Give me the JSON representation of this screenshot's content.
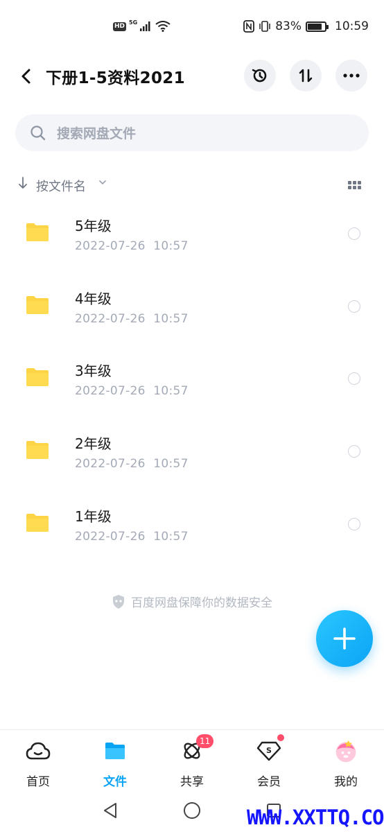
{
  "status_bar": {
    "network": "5G",
    "battery": "83%",
    "battery_level": 0.83,
    "time": "10:59"
  },
  "header": {
    "title": "下册1-5资料2021",
    "history_icon": "history-icon",
    "sort_icon": "sort-swap-icon",
    "more_icon": "more-icon"
  },
  "search": {
    "placeholder": "搜索网盘文件"
  },
  "sort": {
    "label": "按文件名"
  },
  "files": [
    {
      "name": "5年级",
      "date": "2022-07-26",
      "time": "10:57"
    },
    {
      "name": "4年级",
      "date": "2022-07-26",
      "time": "10:57"
    },
    {
      "name": "3年级",
      "date": "2022-07-26",
      "time": "10:57"
    },
    {
      "name": "2年级",
      "date": "2022-07-26",
      "time": "10:57"
    },
    {
      "name": "1年级",
      "date": "2022-07-26",
      "time": "10:57"
    }
  ],
  "security_note": "百度网盘保障你的数据安全",
  "bottom_nav": [
    {
      "label": "首页",
      "icon": "home-cloud-icon"
    },
    {
      "label": "文件",
      "icon": "folder-icon",
      "active": true
    },
    {
      "label": "共享",
      "icon": "share-orbit-icon",
      "badge": "11"
    },
    {
      "label": "会员",
      "icon": "vip-diamond-icon"
    },
    {
      "label": "我的",
      "icon": "avatar-icon"
    }
  ],
  "watermark": "WWW.XXTTQ.COM",
  "colors": {
    "accent": "#0aa4f5",
    "folder": "#fdd445",
    "badge": "#ff4d6a"
  }
}
